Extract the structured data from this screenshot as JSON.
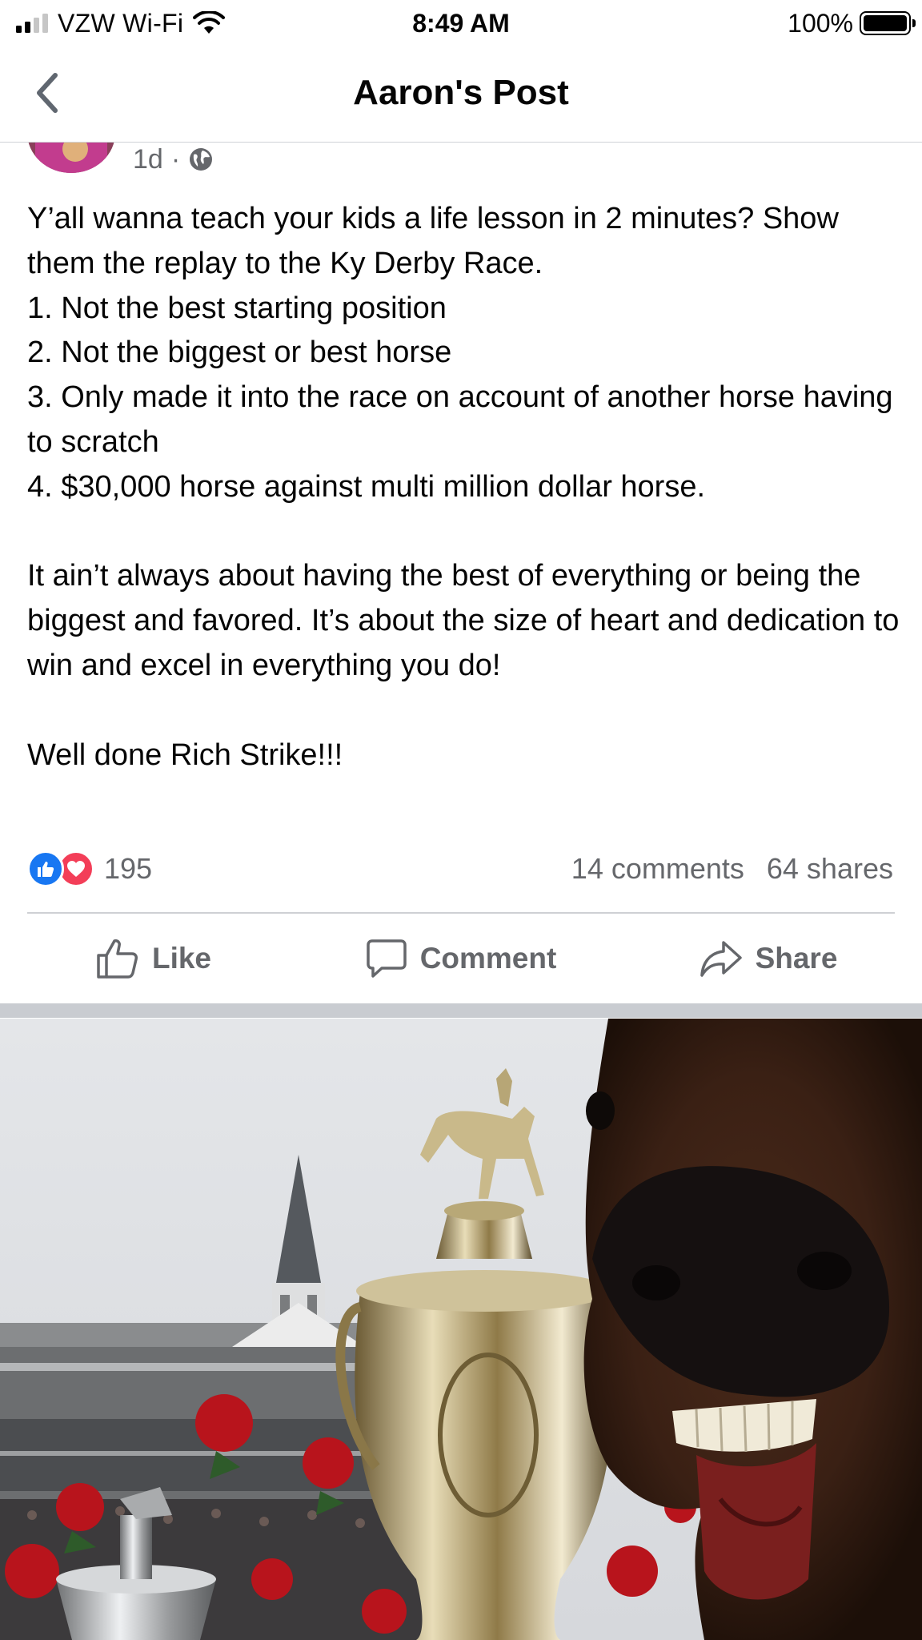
{
  "status_bar": {
    "carrier": "VZW Wi-Fi",
    "time": "8:49 AM",
    "battery": "100%"
  },
  "header": {
    "title": "Aaron's Post"
  },
  "post": {
    "age": "1d",
    "separator": "·",
    "paragraphs": [
      "Y’all wanna teach your kids a life lesson in 2 minutes? Show them the replay to the Ky Derby Race.",
      "1. Not the best starting position",
      "2. Not the biggest or best horse",
      "3. Only made it into the race on account of another horse having to scratch",
      "4. $30,000 horse against multi million dollar horse.",
      "It ain’t always about having the best of everything or being the biggest and favored. It’s about the size of heart and dedication to win and excel in everything you do!",
      "Well done Rich Strike!!!"
    ],
    "reaction_count": "195",
    "comments": "14 comments",
    "shares": "64 shares"
  },
  "actions": {
    "like": "Like",
    "comment": "Comment",
    "share": "Share"
  },
  "colors": {
    "like_blue": "#1877f2",
    "love_red": "#f33e58",
    "meta_gray": "#65676b"
  },
  "icons": [
    "signal-icon",
    "wifi-icon",
    "battery-icon",
    "back-chevron-icon",
    "globe-icon",
    "like-reaction-icon",
    "love-reaction-icon",
    "thumbs-up-icon",
    "comment-bubble-icon",
    "share-arrow-icon"
  ]
}
